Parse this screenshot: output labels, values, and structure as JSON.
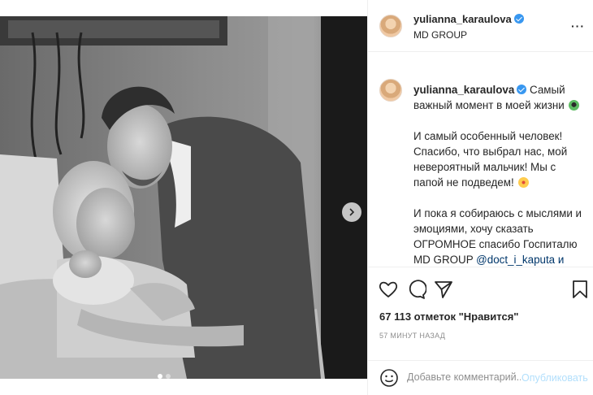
{
  "post": {
    "username": "yulianna_karaulova",
    "location": "MD GROUP"
  },
  "caption": {
    "username": "yulianna_karaulova",
    "line1": "Самый важный момент в моей жизни",
    "line1_emoji": "alien-face-emoji",
    "para2": "И самый особенный человек! Спасибо, что выбрал нас, мой невероятный мальчик! Мы с папой не подведем!",
    "para2_emoji": "smiling-face-with-hearts-emoji",
    "para3": "И пока я собираюсь с мыслями и эмоциями, хочу сказать ОГРОМНОЕ спасибо Госпиталю MD GROUP",
    "para3_tail": "@doct_i_kaputa и всей атар"
  },
  "stats": {
    "likes": "67 113 отметок \"Нравится\"",
    "time": "57 МИНУТ НАЗАД"
  },
  "comment": {
    "placeholder": "Добавьте комментарий...",
    "post_label": "Опубликовать"
  },
  "carousel": {
    "slides": 2,
    "current": 1
  },
  "colors": {
    "verified": "#3897f0",
    "post_disabled": "#b2dffc",
    "mention": "#00376b"
  }
}
